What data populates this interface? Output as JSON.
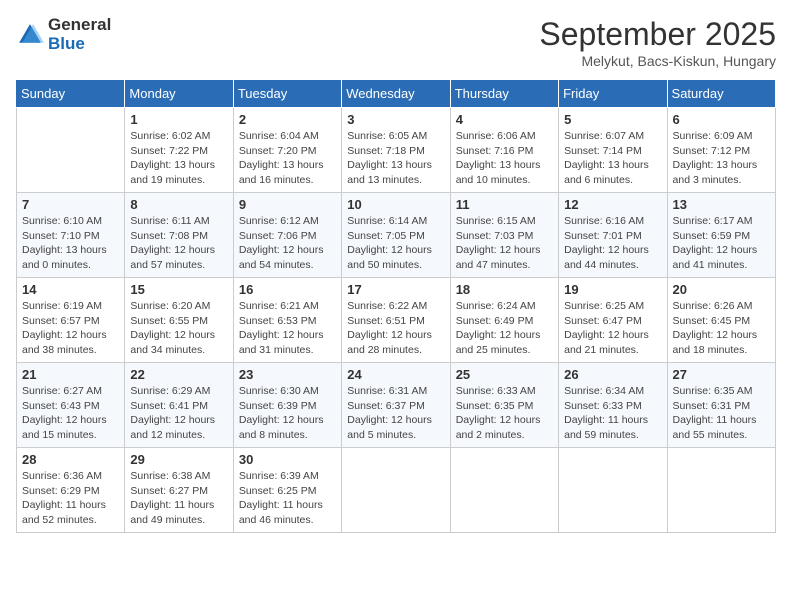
{
  "header": {
    "logo_general": "General",
    "logo_blue": "Blue",
    "month_title": "September 2025",
    "location": "Melykut, Bacs-Kiskun, Hungary"
  },
  "weekdays": [
    "Sunday",
    "Monday",
    "Tuesday",
    "Wednesday",
    "Thursday",
    "Friday",
    "Saturday"
  ],
  "weeks": [
    [
      {
        "day": "",
        "sunrise": "",
        "sunset": "",
        "daylight": ""
      },
      {
        "day": "1",
        "sunrise": "Sunrise: 6:02 AM",
        "sunset": "Sunset: 7:22 PM",
        "daylight": "Daylight: 13 hours and 19 minutes."
      },
      {
        "day": "2",
        "sunrise": "Sunrise: 6:04 AM",
        "sunset": "Sunset: 7:20 PM",
        "daylight": "Daylight: 13 hours and 16 minutes."
      },
      {
        "day": "3",
        "sunrise": "Sunrise: 6:05 AM",
        "sunset": "Sunset: 7:18 PM",
        "daylight": "Daylight: 13 hours and 13 minutes."
      },
      {
        "day": "4",
        "sunrise": "Sunrise: 6:06 AM",
        "sunset": "Sunset: 7:16 PM",
        "daylight": "Daylight: 13 hours and 10 minutes."
      },
      {
        "day": "5",
        "sunrise": "Sunrise: 6:07 AM",
        "sunset": "Sunset: 7:14 PM",
        "daylight": "Daylight: 13 hours and 6 minutes."
      },
      {
        "day": "6",
        "sunrise": "Sunrise: 6:09 AM",
        "sunset": "Sunset: 7:12 PM",
        "daylight": "Daylight: 13 hours and 3 minutes."
      }
    ],
    [
      {
        "day": "7",
        "sunrise": "Sunrise: 6:10 AM",
        "sunset": "Sunset: 7:10 PM",
        "daylight": "Daylight: 13 hours and 0 minutes."
      },
      {
        "day": "8",
        "sunrise": "Sunrise: 6:11 AM",
        "sunset": "Sunset: 7:08 PM",
        "daylight": "Daylight: 12 hours and 57 minutes."
      },
      {
        "day": "9",
        "sunrise": "Sunrise: 6:12 AM",
        "sunset": "Sunset: 7:06 PM",
        "daylight": "Daylight: 12 hours and 54 minutes."
      },
      {
        "day": "10",
        "sunrise": "Sunrise: 6:14 AM",
        "sunset": "Sunset: 7:05 PM",
        "daylight": "Daylight: 12 hours and 50 minutes."
      },
      {
        "day": "11",
        "sunrise": "Sunrise: 6:15 AM",
        "sunset": "Sunset: 7:03 PM",
        "daylight": "Daylight: 12 hours and 47 minutes."
      },
      {
        "day": "12",
        "sunrise": "Sunrise: 6:16 AM",
        "sunset": "Sunset: 7:01 PM",
        "daylight": "Daylight: 12 hours and 44 minutes."
      },
      {
        "day": "13",
        "sunrise": "Sunrise: 6:17 AM",
        "sunset": "Sunset: 6:59 PM",
        "daylight": "Daylight: 12 hours and 41 minutes."
      }
    ],
    [
      {
        "day": "14",
        "sunrise": "Sunrise: 6:19 AM",
        "sunset": "Sunset: 6:57 PM",
        "daylight": "Daylight: 12 hours and 38 minutes."
      },
      {
        "day": "15",
        "sunrise": "Sunrise: 6:20 AM",
        "sunset": "Sunset: 6:55 PM",
        "daylight": "Daylight: 12 hours and 34 minutes."
      },
      {
        "day": "16",
        "sunrise": "Sunrise: 6:21 AM",
        "sunset": "Sunset: 6:53 PM",
        "daylight": "Daylight: 12 hours and 31 minutes."
      },
      {
        "day": "17",
        "sunrise": "Sunrise: 6:22 AM",
        "sunset": "Sunset: 6:51 PM",
        "daylight": "Daylight: 12 hours and 28 minutes."
      },
      {
        "day": "18",
        "sunrise": "Sunrise: 6:24 AM",
        "sunset": "Sunset: 6:49 PM",
        "daylight": "Daylight: 12 hours and 25 minutes."
      },
      {
        "day": "19",
        "sunrise": "Sunrise: 6:25 AM",
        "sunset": "Sunset: 6:47 PM",
        "daylight": "Daylight: 12 hours and 21 minutes."
      },
      {
        "day": "20",
        "sunrise": "Sunrise: 6:26 AM",
        "sunset": "Sunset: 6:45 PM",
        "daylight": "Daylight: 12 hours and 18 minutes."
      }
    ],
    [
      {
        "day": "21",
        "sunrise": "Sunrise: 6:27 AM",
        "sunset": "Sunset: 6:43 PM",
        "daylight": "Daylight: 12 hours and 15 minutes."
      },
      {
        "day": "22",
        "sunrise": "Sunrise: 6:29 AM",
        "sunset": "Sunset: 6:41 PM",
        "daylight": "Daylight: 12 hours and 12 minutes."
      },
      {
        "day": "23",
        "sunrise": "Sunrise: 6:30 AM",
        "sunset": "Sunset: 6:39 PM",
        "daylight": "Daylight: 12 hours and 8 minutes."
      },
      {
        "day": "24",
        "sunrise": "Sunrise: 6:31 AM",
        "sunset": "Sunset: 6:37 PM",
        "daylight": "Daylight: 12 hours and 5 minutes."
      },
      {
        "day": "25",
        "sunrise": "Sunrise: 6:33 AM",
        "sunset": "Sunset: 6:35 PM",
        "daylight": "Daylight: 12 hours and 2 minutes."
      },
      {
        "day": "26",
        "sunrise": "Sunrise: 6:34 AM",
        "sunset": "Sunset: 6:33 PM",
        "daylight": "Daylight: 11 hours and 59 minutes."
      },
      {
        "day": "27",
        "sunrise": "Sunrise: 6:35 AM",
        "sunset": "Sunset: 6:31 PM",
        "daylight": "Daylight: 11 hours and 55 minutes."
      }
    ],
    [
      {
        "day": "28",
        "sunrise": "Sunrise: 6:36 AM",
        "sunset": "Sunset: 6:29 PM",
        "daylight": "Daylight: 11 hours and 52 minutes."
      },
      {
        "day": "29",
        "sunrise": "Sunrise: 6:38 AM",
        "sunset": "Sunset: 6:27 PM",
        "daylight": "Daylight: 11 hours and 49 minutes."
      },
      {
        "day": "30",
        "sunrise": "Sunrise: 6:39 AM",
        "sunset": "Sunset: 6:25 PM",
        "daylight": "Daylight: 11 hours and 46 minutes."
      },
      {
        "day": "",
        "sunrise": "",
        "sunset": "",
        "daylight": ""
      },
      {
        "day": "",
        "sunrise": "",
        "sunset": "",
        "daylight": ""
      },
      {
        "day": "",
        "sunrise": "",
        "sunset": "",
        "daylight": ""
      },
      {
        "day": "",
        "sunrise": "",
        "sunset": "",
        "daylight": ""
      }
    ]
  ]
}
